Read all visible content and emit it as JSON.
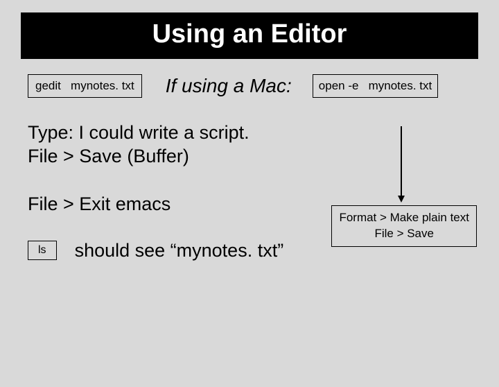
{
  "title": "Using an Editor",
  "linux_cmd": "gedit   mynotes. txt",
  "mac_label": "If using a Mac:",
  "mac_cmd": "open -e   mynotes. txt",
  "type_line": "Type:  I could write a script.",
  "save_line": "File > Save (Buffer)",
  "exit_line": "File > Exit emacs",
  "format_box_line1": "Format > Make plain text",
  "format_box_line2": "File > Save",
  "ls_cmd": "ls",
  "ls_text": "should see  “mynotes. txt”"
}
